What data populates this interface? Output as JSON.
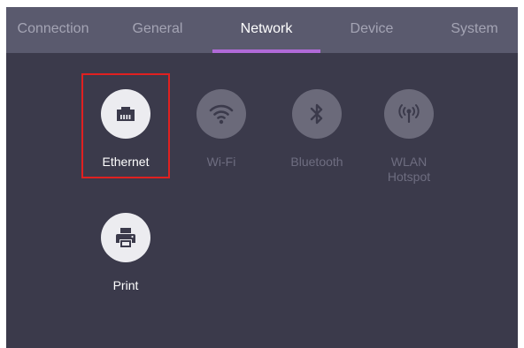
{
  "tabs": [
    {
      "label": "Connection",
      "active": false
    },
    {
      "label": "General",
      "active": false
    },
    {
      "label": "Network",
      "active": true
    },
    {
      "label": "Device",
      "active": false
    },
    {
      "label": "System",
      "active": false
    }
  ],
  "items": [
    {
      "label": "Ethernet",
      "icon": "ethernet-icon",
      "enabled": true,
      "selected": true
    },
    {
      "label": "Wi-Fi",
      "icon": "wifi-icon",
      "enabled": false
    },
    {
      "label": "Bluetooth",
      "icon": "bluetooth-icon",
      "enabled": false
    },
    {
      "label_line1": "WLAN",
      "label_line2": "Hotspot",
      "icon": "hotspot-icon",
      "enabled": false
    },
    {
      "label": "Print",
      "icon": "printer-icon",
      "enabled": true
    }
  ],
  "colors": {
    "panel_bg": "#3b3a4b",
    "tabbar_bg": "#5a5a6e",
    "accent": "#b06ad8",
    "selection_border": "#e02020"
  }
}
